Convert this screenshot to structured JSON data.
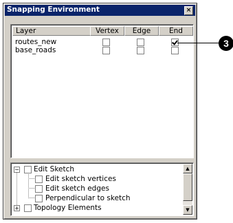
{
  "window": {
    "title": "Snapping Environment",
    "close_glyph": "×"
  },
  "layer_table": {
    "columns": [
      "Layer",
      "Vertex",
      "Edge",
      "End"
    ],
    "rows": [
      {
        "layer": "routes_new",
        "vertex": false,
        "edge": false,
        "end": true
      },
      {
        "layer": "base_roads",
        "vertex": false,
        "edge": false,
        "end": false
      }
    ]
  },
  "tree": {
    "items": [
      {
        "label": "Edit Sketch",
        "expander": "−",
        "checked": false
      },
      {
        "label": "Edit sketch vertices",
        "checked": false
      },
      {
        "label": "Edit sketch edges",
        "checked": false
      },
      {
        "label": "Perpendicular to sketch",
        "checked": false
      },
      {
        "label": "Topology Elements",
        "expander": "+",
        "checked": false
      }
    ],
    "scroll_up_glyph": "▲",
    "scroll_down_glyph": "▼"
  },
  "callout": {
    "number": "3"
  }
}
